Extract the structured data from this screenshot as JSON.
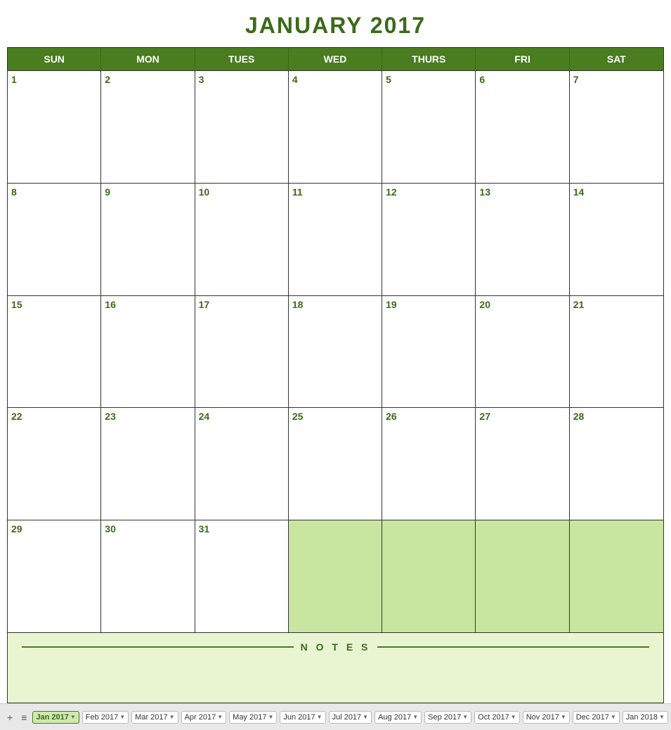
{
  "title": "JANUARY 2017",
  "dayHeaders": [
    "SUN",
    "MON",
    "TUES",
    "WED",
    "THURS",
    "FRI",
    "SAT"
  ],
  "weeks": [
    [
      {
        "num": "1"
      },
      {
        "num": "2"
      },
      {
        "num": "3"
      },
      {
        "num": "4"
      },
      {
        "num": "5"
      },
      {
        "num": "6"
      },
      {
        "num": "7"
      }
    ],
    [
      {
        "num": "8"
      },
      {
        "num": "9"
      },
      {
        "num": "10"
      },
      {
        "num": "11"
      },
      {
        "num": "12"
      },
      {
        "num": "13"
      },
      {
        "num": "14"
      }
    ],
    [
      {
        "num": "15"
      },
      {
        "num": "16"
      },
      {
        "num": "17"
      },
      {
        "num": "18"
      },
      {
        "num": "19"
      },
      {
        "num": "20"
      },
      {
        "num": "21"
      }
    ],
    [
      {
        "num": "22"
      },
      {
        "num": "23"
      },
      {
        "num": "24"
      },
      {
        "num": "25"
      },
      {
        "num": "26"
      },
      {
        "num": "27"
      },
      {
        "num": "28"
      }
    ],
    [
      {
        "num": "29"
      },
      {
        "num": "30"
      },
      {
        "num": "31"
      },
      {
        "num": "",
        "empty": true
      },
      {
        "num": "",
        "empty": true
      },
      {
        "num": "",
        "empty": true
      },
      {
        "num": "",
        "empty": true
      }
    ]
  ],
  "notes": {
    "label": "N O T E S"
  },
  "bottomBar": {
    "addIcon": "+",
    "menuIcon": "≡",
    "tabs": [
      {
        "label": "Jan 2017",
        "active": true
      },
      {
        "label": "Feb 2017",
        "active": false
      },
      {
        "label": "Mar 2017",
        "active": false
      },
      {
        "label": "Apr 2017",
        "active": false
      },
      {
        "label": "May 2017",
        "active": false
      },
      {
        "label": "Jun 2017",
        "active": false
      },
      {
        "label": "Jul 2017",
        "active": false
      },
      {
        "label": "Aug 2017",
        "active": false
      },
      {
        "label": "Sep 2017",
        "active": false
      },
      {
        "label": "Oct 2017",
        "active": false
      },
      {
        "label": "Nov 2017",
        "active": false
      },
      {
        "label": "Dec 2017",
        "active": false
      },
      {
        "label": "Jan 2018",
        "active": false
      }
    ]
  }
}
